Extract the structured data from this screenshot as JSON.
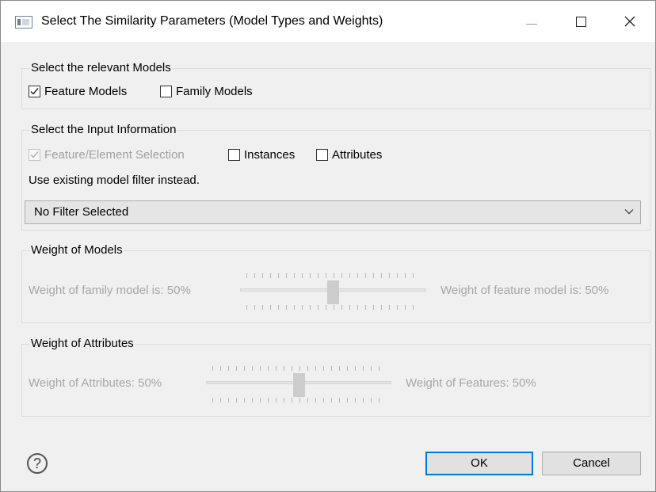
{
  "window": {
    "title": "Select The Similarity Parameters (Model Types and Weights)"
  },
  "models_group": {
    "title": "Select the relevant Models",
    "feature_models": {
      "label": "Feature Models",
      "checked": true
    },
    "family_models": {
      "label": "Family Models",
      "checked": false
    }
  },
  "input_group": {
    "title": "Select the Input Information",
    "feature_element_selection": {
      "label": "Feature/Element Selection",
      "checked": true,
      "enabled": false
    },
    "instances": {
      "label": "Instances",
      "checked": false
    },
    "attributes": {
      "label": "Attributes",
      "checked": false
    },
    "filter_label": "Use existing model filter instead.",
    "filter_select": {
      "value": "No Filter Selected"
    }
  },
  "weight_models_group": {
    "title": "Weight of Models",
    "left_label": "Weight of family model is: 50%",
    "right_label": "Weight of feature model is: 50%",
    "slider_value_percent": 50,
    "enabled": false
  },
  "weight_attributes_group": {
    "title": "Weight of Attributes",
    "left_label": "Weight of Attributes: 50%",
    "right_label": "Weight of Features: 50%",
    "slider_value_percent": 50,
    "enabled": false
  },
  "footer": {
    "ok_label": "OK",
    "cancel_label": "Cancel",
    "help_glyph": "?"
  },
  "colors": {
    "accent": "#0078d7",
    "disabled_text": "#a6a6a6"
  }
}
